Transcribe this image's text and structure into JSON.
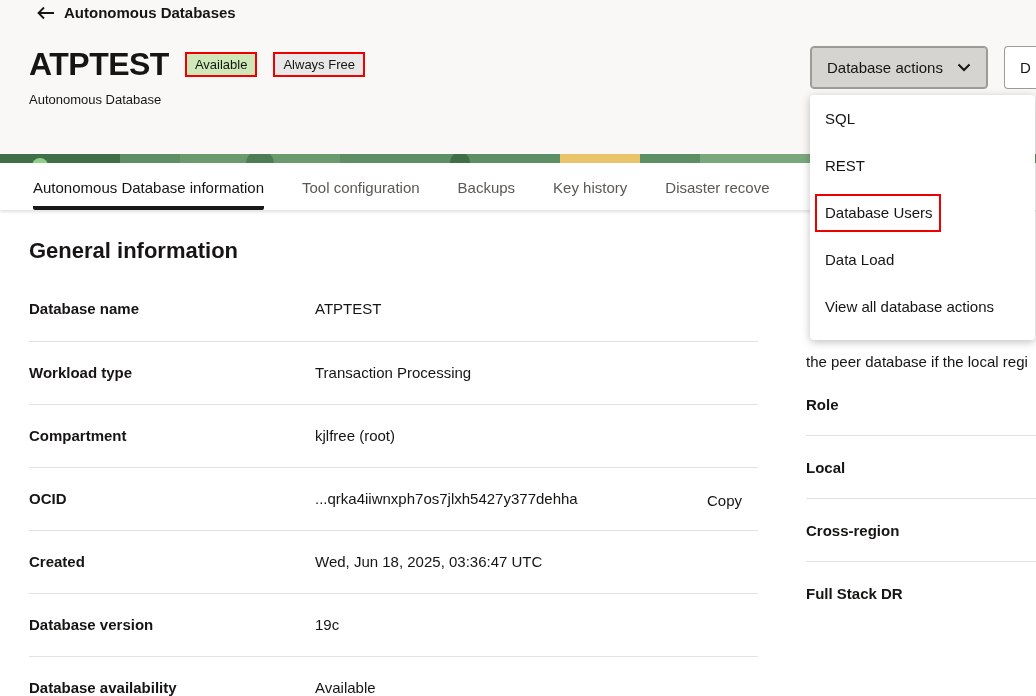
{
  "back_link": {
    "label": "Autonomous Databases"
  },
  "header": {
    "title": "ATPTEST",
    "subtitle": "Autonomous Database",
    "badges": [
      {
        "label": "Available",
        "kind": "status",
        "highlighted": true
      },
      {
        "label": "Always Free",
        "kind": "tag",
        "highlighted": true
      }
    ],
    "actions": [
      {
        "label": "Database actions",
        "kind": "dropdown",
        "expanded": true
      },
      {
        "label": "D",
        "kind": "button"
      }
    ]
  },
  "tabs": [
    {
      "label": "Autonomous Database information",
      "selected": true
    },
    {
      "label": "Tool configuration",
      "selected": false
    },
    {
      "label": "Backups",
      "selected": false
    },
    {
      "label": "Key history",
      "selected": false
    },
    {
      "label": "Disaster recove",
      "selected": false
    }
  ],
  "general_information": {
    "title": "General information",
    "rows": [
      {
        "label": "Database name",
        "value": "ATPTEST"
      },
      {
        "label": "Workload type",
        "value": "Transaction Processing"
      },
      {
        "label": "Compartment",
        "value": "kjlfree (root)"
      },
      {
        "label": "OCID",
        "value": "...qrka4iiwnxph7os7jlxh5427y377dehha",
        "action": "Copy"
      },
      {
        "label": "Created",
        "value": "Wed, Jun 18, 2025, 03:36:47 UTC"
      },
      {
        "label": "Database version",
        "value": "19c"
      },
      {
        "label": "Database availability",
        "value": "Available"
      }
    ]
  },
  "disaster_recovery": {
    "description": "the peer database if the local regi",
    "rows": [
      {
        "label": "Role"
      },
      {
        "label": "Local"
      },
      {
        "label": "Cross-region"
      },
      {
        "label": "Full Stack DR"
      }
    ]
  },
  "action_menu": {
    "items": [
      {
        "label": "SQL",
        "highlighted": false
      },
      {
        "label": "REST",
        "highlighted": false
      },
      {
        "label": "Database Users",
        "highlighted": true
      },
      {
        "label": "Data Load",
        "highlighted": false
      },
      {
        "label": "View all database actions",
        "highlighted": false
      }
    ]
  }
}
